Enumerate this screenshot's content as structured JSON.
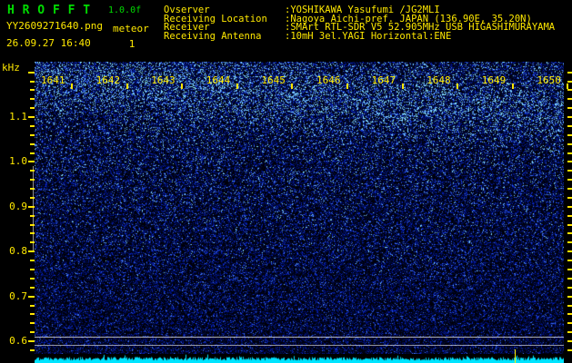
{
  "app": {
    "title": "H R O F F T",
    "version": "1.0.0f"
  },
  "session": {
    "filename": "YY2609271640.png",
    "mode": "meteor",
    "datetime": "26.09.27 16:40",
    "count": "1"
  },
  "station": {
    "rows": [
      {
        "label": "Ovserver",
        "value": ":YOSHIKAWA Yasufumi /JG2MLI"
      },
      {
        "label": "Receiving Location",
        "value": ":Nagoya Aichi-pref. JAPAN (136.90E, 35.20N)"
      },
      {
        "label": "Receiver",
        "value": ":SMArt RTL-SDR V5 52.905MHz USB HIGASHIMURAYAMA"
      },
      {
        "label": "Receiving Antenna",
        "value": ":10mH 3el.YAGI Horizontal:ENE"
      }
    ]
  },
  "spectrogram": {
    "y_axis_unit": "kHz",
    "y_tick_labels": [
      "1.1",
      "1.0",
      "0.9",
      "0.8",
      "0.7",
      "0.6"
    ],
    "x_tick_labels": [
      "1641",
      "1642",
      "1643",
      "1644",
      "1645",
      "1646",
      "1647",
      "1648",
      "1649",
      "1650"
    ],
    "colors": {
      "background": "#000000",
      "noise_dim_blue": "#000C40",
      "noise_mid_blue": "#0A28C8",
      "noise_bright": "#3C6EF0",
      "noise_peak_cyan": "#82DCFF",
      "level_strip_cyan": "#00E4FF",
      "text_yellow": "#FFE900",
      "title_green": "#00DC00",
      "reference_line_grey": "#E1E1E1",
      "event_marker_yellow": "#FFF000"
    }
  }
}
